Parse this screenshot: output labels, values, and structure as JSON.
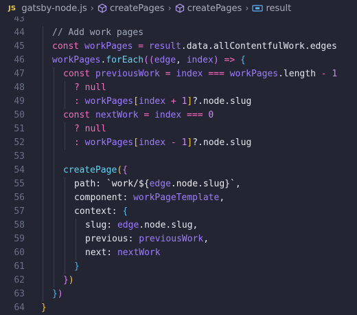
{
  "breadcrumb": {
    "lang_badge": "JS",
    "items": [
      "gatsby-node.js",
      "createPages",
      "createPages",
      "result"
    ]
  },
  "editor": {
    "lines": [
      {
        "n": "43",
        "indent": 0,
        "tokens": []
      },
      {
        "n": "44",
        "indent": 1,
        "tokens": [
          [
            "comment",
            "// Add work pages"
          ]
        ]
      },
      {
        "n": "45",
        "indent": 1,
        "tokens": [
          [
            "kw",
            "const "
          ],
          [
            "var",
            "workPages"
          ],
          [
            "kw",
            " = "
          ],
          [
            "var",
            "result"
          ],
          [
            "text",
            ".data.allContentfulWork.edges"
          ]
        ]
      },
      {
        "n": "46",
        "indent": 1,
        "tokens": [
          [
            "var",
            "workPages"
          ],
          [
            "text",
            "."
          ],
          [
            "fn",
            "forEach"
          ],
          [
            "brace2",
            "(("
          ],
          [
            "var",
            "edge"
          ],
          [
            "text",
            ", "
          ],
          [
            "var",
            "index"
          ],
          [
            "brace2",
            ")"
          ],
          [
            "kw",
            " => "
          ],
          [
            "brace3",
            "{"
          ]
        ]
      },
      {
        "n": "47",
        "indent": 2,
        "tokens": [
          [
            "kw",
            "const "
          ],
          [
            "var",
            "previousWork"
          ],
          [
            "kw",
            " = "
          ],
          [
            "var",
            "index"
          ],
          [
            "kw",
            " === "
          ],
          [
            "var",
            "workPages"
          ],
          [
            "text",
            ".length "
          ],
          [
            "kw",
            "- "
          ],
          [
            "num",
            "1"
          ]
        ]
      },
      {
        "n": "48",
        "indent": 3,
        "tokens": [
          [
            "kw",
            "? "
          ],
          [
            "kw",
            "null"
          ]
        ]
      },
      {
        "n": "49",
        "indent": 3,
        "tokens": [
          [
            "kw",
            ": "
          ],
          [
            "var",
            "workPages"
          ],
          [
            "brace",
            "["
          ],
          [
            "var",
            "index"
          ],
          [
            "kw",
            " + "
          ],
          [
            "num",
            "1"
          ],
          [
            "brace",
            "]"
          ],
          [
            "text",
            "?.node.slug"
          ]
        ]
      },
      {
        "n": "50",
        "indent": 2,
        "tokens": [
          [
            "kw",
            "const "
          ],
          [
            "var",
            "nextWork"
          ],
          [
            "kw",
            " = "
          ],
          [
            "var",
            "index"
          ],
          [
            "kw",
            " === "
          ],
          [
            "num",
            "0"
          ]
        ]
      },
      {
        "n": "51",
        "indent": 3,
        "tokens": [
          [
            "kw",
            "? "
          ],
          [
            "kw",
            "null"
          ]
        ]
      },
      {
        "n": "52",
        "indent": 3,
        "tokens": [
          [
            "kw",
            ": "
          ],
          [
            "var",
            "workPages"
          ],
          [
            "brace",
            "["
          ],
          [
            "var",
            "index"
          ],
          [
            "kw",
            " - "
          ],
          [
            "num",
            "1"
          ],
          [
            "brace",
            "]"
          ],
          [
            "text",
            "?.node.slug"
          ]
        ]
      },
      {
        "n": "53",
        "indent": 0,
        "tokens": []
      },
      {
        "n": "54",
        "indent": 2,
        "tokens": [
          [
            "fn",
            "createPage"
          ],
          [
            "brace",
            "("
          ],
          [
            "brace2",
            "{"
          ]
        ]
      },
      {
        "n": "55",
        "indent": 3,
        "tokens": [
          [
            "text",
            "path: "
          ],
          [
            "str",
            "`work/${"
          ],
          [
            "var",
            "edge"
          ],
          [
            "str",
            ".node.slug}`"
          ],
          [
            "text",
            ","
          ]
        ]
      },
      {
        "n": "56",
        "indent": 3,
        "tokens": [
          [
            "text",
            "component: "
          ],
          [
            "var",
            "workPageTemplate"
          ],
          [
            "text",
            ","
          ]
        ]
      },
      {
        "n": "57",
        "indent": 3,
        "tokens": [
          [
            "text",
            "context: "
          ],
          [
            "brace3",
            "{"
          ]
        ]
      },
      {
        "n": "58",
        "indent": 4,
        "tokens": [
          [
            "text",
            "slug: "
          ],
          [
            "var",
            "edge"
          ],
          [
            "text",
            ".node.slug,"
          ]
        ]
      },
      {
        "n": "59",
        "indent": 4,
        "tokens": [
          [
            "text",
            "previous: "
          ],
          [
            "var",
            "previousWork"
          ],
          [
            "text",
            ","
          ]
        ]
      },
      {
        "n": "60",
        "indent": 4,
        "tokens": [
          [
            "text",
            "next: "
          ],
          [
            "var",
            "nextWork"
          ]
        ]
      },
      {
        "n": "61",
        "indent": 3,
        "tokens": [
          [
            "brace3",
            "}"
          ]
        ]
      },
      {
        "n": "62",
        "indent": 2,
        "tokens": [
          [
            "brace2",
            "}"
          ],
          [
            "brace",
            ")"
          ]
        ]
      },
      {
        "n": "63",
        "indent": 1,
        "tokens": [
          [
            "brace3",
            "}"
          ],
          [
            "brace2",
            ")"
          ]
        ]
      },
      {
        "n": "64",
        "indent": 0,
        "tokens": [
          [
            "brace",
            "}"
          ]
        ]
      }
    ]
  }
}
